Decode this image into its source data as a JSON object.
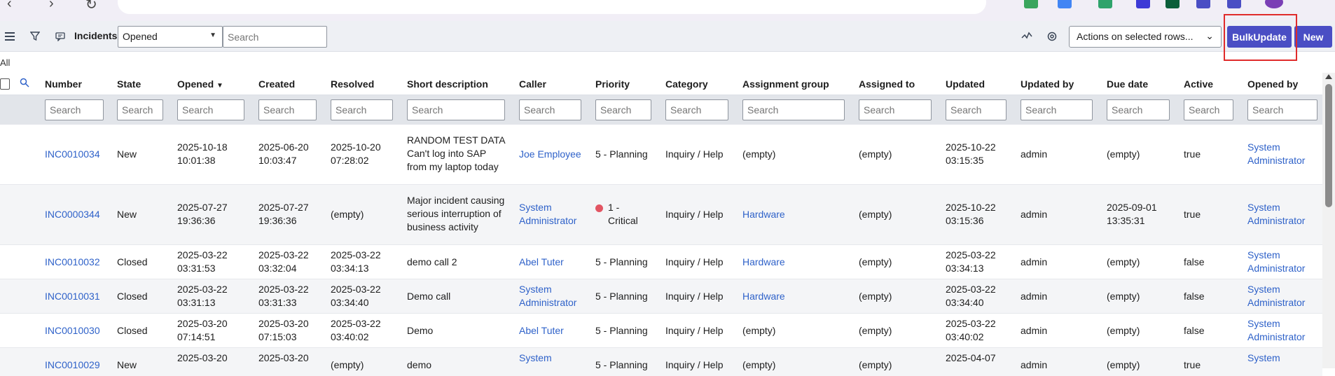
{
  "toolbar": {
    "list_title": "Incidents",
    "filter_select_value": "Opened",
    "search_placeholder": "Search",
    "actions_select_value": "Actions on selected rows...",
    "bulk_update_label": "BulkUpdate",
    "new_label": "New",
    "accent_color": "#4a4ec4",
    "icons": [
      "hamburger-menu-icon",
      "filter-icon",
      "chat-bubble-icon",
      "sparkline-icon",
      "settings-gear-icon"
    ]
  },
  "breadcrumb": "All",
  "columns": [
    "Number",
    "State",
    "Opened",
    "Created",
    "Resolved",
    "Short description",
    "Caller",
    "Priority",
    "Category",
    "Assignment group",
    "Assigned to",
    "Updated",
    "Updated by",
    "Due date",
    "Active",
    "Opened by"
  ],
  "sort": {
    "column": "Opened",
    "direction": "descending"
  },
  "column_search_placeholder": "Search",
  "rows": [
    {
      "number": "INC0010034",
      "state": "New",
      "opened": "2025-10-18\n10:01:38",
      "created": "2025-06-20\n10:03:47",
      "resolved": "2025-10-20\n07:28:02",
      "short_description": "RANDOM TEST DATA\nCan't log into SAP\nfrom my laptop today",
      "caller": "Joe Employee",
      "priority": "5 - Planning",
      "category": "Inquiry / Help",
      "assignment_group": "(empty)",
      "assigned_to": "(empty)",
      "updated": "2025-10-22\n03:15:35",
      "updated_by": "admin",
      "due_date": "(empty)",
      "active": "true",
      "opened_by": "System\nAdministrator"
    },
    {
      "number": "INC0000344",
      "state": "New",
      "opened": "2025-07-27\n19:36:36",
      "created": "2025-07-27\n19:36:36",
      "resolved": "(empty)",
      "short_description": "Major incident causing\nserious interruption of\nbusiness activity",
      "caller": "System\nAdministrator",
      "priority": "1 -\nCritical",
      "category": "Inquiry / Help",
      "assignment_group": "Hardware",
      "assigned_to": "(empty)",
      "updated": "2025-10-22\n03:15:36",
      "updated_by": "admin",
      "due_date": "2025-09-01\n13:35:31",
      "active": "true",
      "opened_by": "System\nAdministrator"
    },
    {
      "number": "INC0010032",
      "state": "Closed",
      "opened": "2025-03-22\n03:31:53",
      "created": "2025-03-22\n03:32:04",
      "resolved": "2025-03-22\n03:34:13",
      "short_description": "demo call 2",
      "caller": "Abel Tuter",
      "priority": "5 - Planning",
      "category": "Inquiry / Help",
      "assignment_group": "Hardware",
      "assigned_to": "(empty)",
      "updated": "2025-03-22\n03:34:13",
      "updated_by": "admin",
      "due_date": "(empty)",
      "active": "false",
      "opened_by": "System\nAdministrator"
    },
    {
      "number": "INC0010031",
      "state": "Closed",
      "opened": "2025-03-22\n03:31:13",
      "created": "2025-03-22\n03:31:33",
      "resolved": "2025-03-22\n03:34:40",
      "short_description": "Demo call",
      "caller": "System\nAdministrator",
      "priority": "5 - Planning",
      "category": "Inquiry / Help",
      "assignment_group": "Hardware",
      "assigned_to": "(empty)",
      "updated": "2025-03-22\n03:34:40",
      "updated_by": "admin",
      "due_date": "(empty)",
      "active": "false",
      "opened_by": "System\nAdministrator"
    },
    {
      "number": "INC0010030",
      "state": "Closed",
      "opened": "2025-03-20\n07:14:51",
      "created": "2025-03-20\n07:15:03",
      "resolved": "2025-03-22\n03:40:02",
      "short_description": "Demo",
      "caller": "Abel Tuter",
      "priority": "5 - Planning",
      "category": "Inquiry / Help",
      "assignment_group": "(empty)",
      "assigned_to": "(empty)",
      "updated": "2025-03-22\n03:40:02",
      "updated_by": "admin",
      "due_date": "(empty)",
      "active": "false",
      "opened_by": "System\nAdministrator"
    },
    {
      "number": "INC0010029",
      "state": "New",
      "opened": "2025-03-20",
      "created": "2025-03-20",
      "resolved": "(empty)",
      "short_description": "demo",
      "caller": "System",
      "priority": "5 - Planning",
      "category": "Inquiry / Help",
      "assignment_group": "(empty)",
      "assigned_to": "(empty)",
      "updated": "2025-04-07",
      "updated_by": "admin",
      "due_date": "(empty)",
      "active": "true",
      "opened_by": "System"
    }
  ]
}
